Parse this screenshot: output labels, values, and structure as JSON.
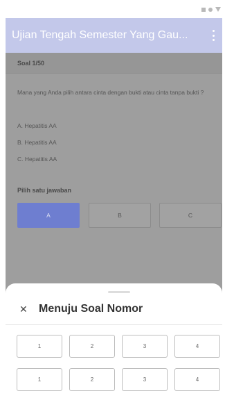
{
  "status": {
    "icons": [
      "square-icon",
      "circle-icon",
      "triangle-icon"
    ]
  },
  "app_bar": {
    "title": "Ujian Tengah Semester Yang Gau...",
    "menu_icon": "more-vert-icon"
  },
  "question": {
    "number": "Soal 1/50",
    "text": "Mana yang Anda pilih antara cinta dengan bukti atau cinta tanpa bukti ?",
    "options": [
      "A. Hepatitis AA",
      "B. Hepatitis AA",
      "C. Hepatitis AA"
    ]
  },
  "answer": {
    "prompt": "Pilih satu jawaban",
    "buttons": [
      "A",
      "B",
      "C"
    ],
    "selected": "A"
  },
  "sheet": {
    "title": "Menuju Soal Nomor",
    "close_icon": "close-icon",
    "rows": [
      [
        "1",
        "2",
        "3",
        "4"
      ],
      [
        "1",
        "2",
        "3",
        "4"
      ]
    ]
  },
  "colors": {
    "app_bar": "#c3c8ea",
    "selected": "#6e7ed0",
    "overlay": "#9e9e9e"
  }
}
